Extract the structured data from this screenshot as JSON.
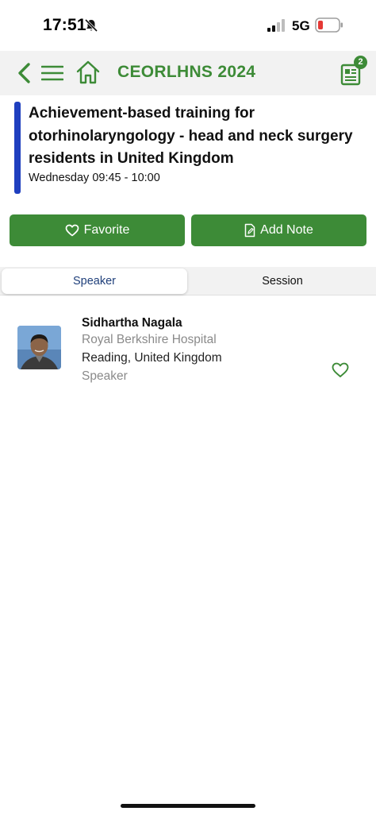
{
  "status_bar": {
    "time": "17:51",
    "network": "5G",
    "battery_color": "#e53935"
  },
  "header": {
    "title": "CEORLHNS 2024",
    "notes_badge": "2",
    "accent_color": "#3d8b37",
    "icons": [
      "back-icon",
      "menu-icon",
      "home-icon",
      "notes-icon"
    ]
  },
  "session": {
    "title": "Achievement-based training for otorhinolaryngology - head and neck surgery residents in United Kingdom",
    "time": "Wednesday 09:45 - 10:00",
    "accent_color": "#1f3fbf"
  },
  "actions": {
    "favorite_label": "Favorite",
    "add_note_label": "Add Note"
  },
  "tabs": {
    "speaker": "Speaker",
    "session": "Session"
  },
  "speaker": {
    "name": "Sidhartha Nagala",
    "organization": "Royal Berkshire Hospital",
    "location": "Reading, United Kingdom",
    "role": "Speaker"
  }
}
